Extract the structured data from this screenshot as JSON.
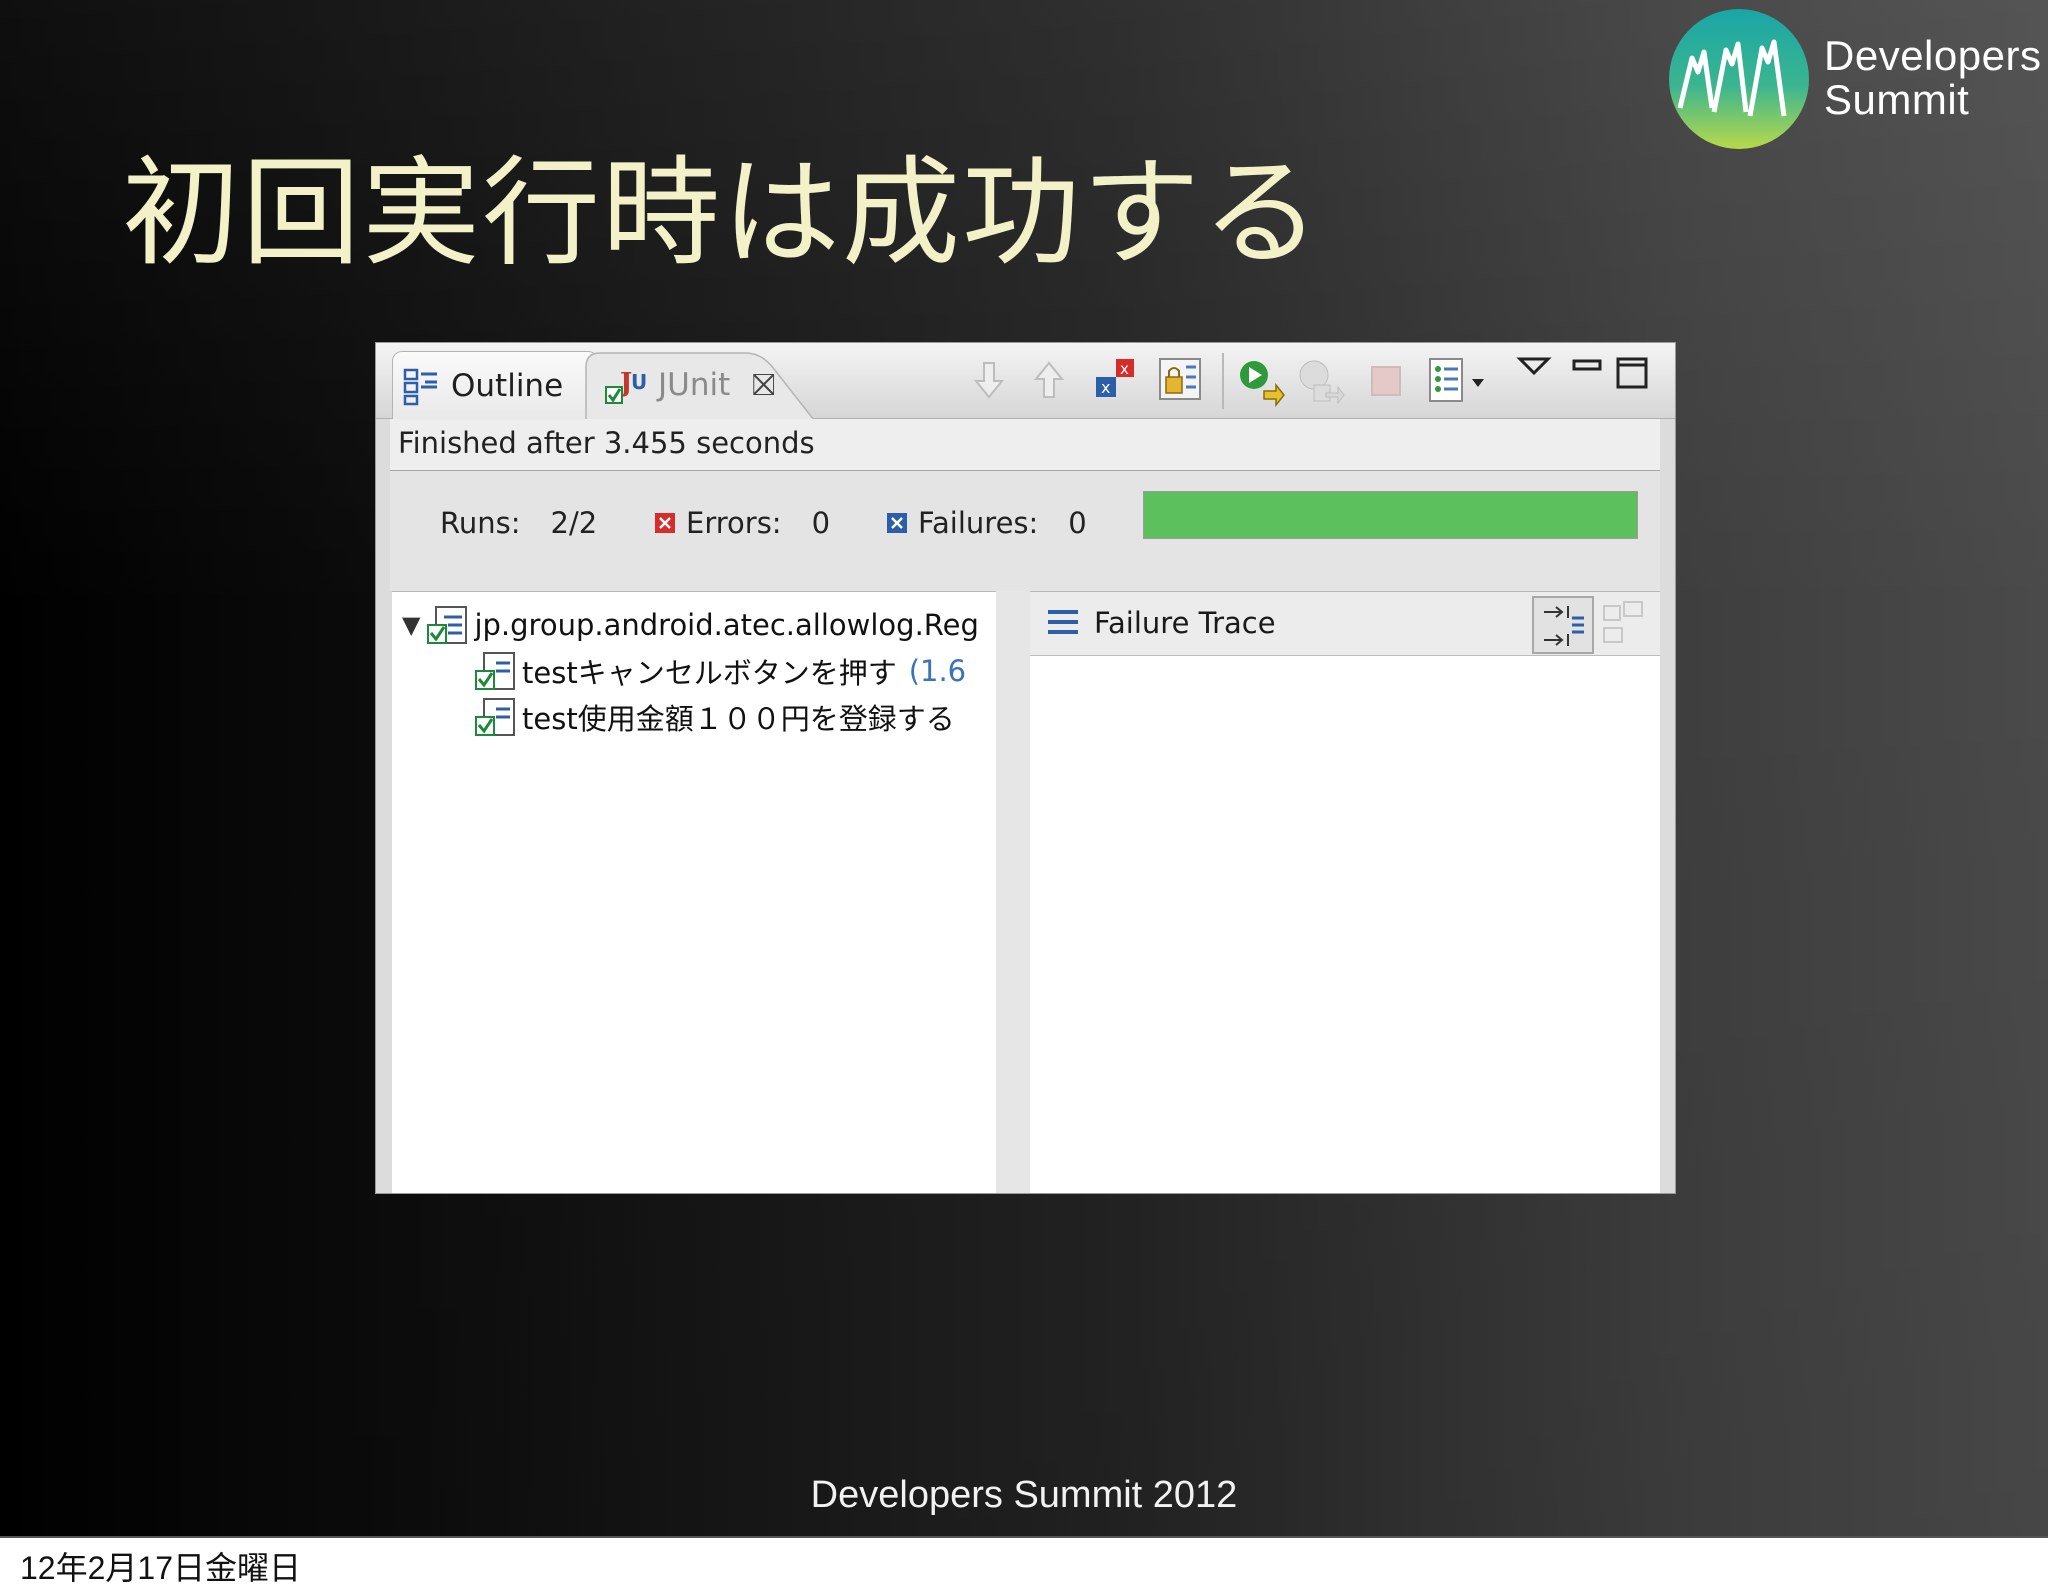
{
  "slide": {
    "title": "初回実行時は成功する",
    "footer": "Developers Summit 2012",
    "date_caption": "12年2月17日金曜日"
  },
  "logo": {
    "line1": "Developers",
    "line2": "Summit"
  },
  "eclipse_view": {
    "tabs": [
      {
        "label": "Outline",
        "icon": "outline-icon",
        "active": false
      },
      {
        "label": "JUnit",
        "icon": "junit-icon",
        "active": true,
        "close_glyph": "⛝"
      }
    ],
    "toolbar_icons": [
      "next-failure-icon",
      "previous-failure-icon",
      "show-failures-only-icon",
      "scroll-lock-icon",
      "rerun-test-icon",
      "rerun-failed-first-icon",
      "stop-icon",
      "test-run-history-icon",
      "view-menu-icon",
      "minimize-icon",
      "maximize-icon"
    ],
    "status": "Finished after 3.455 seconds",
    "counters": {
      "runs_label": "Runs:",
      "runs_value": "2/2",
      "errors_label": "Errors:",
      "errors_value": "0",
      "failures_label": "Failures:",
      "failures_value": "0"
    },
    "progress": {
      "fraction": 1.0,
      "color": "#5cc05c"
    },
    "tree": [
      {
        "label": "jp.group.android.atec.allowlog.Reg",
        "icon": "test-suite-icon",
        "expanded": true,
        "level": 0
      },
      {
        "label": "testキャンセルボタンを押す",
        "time": "(1.6",
        "icon": "test-pass-icon",
        "level": 1
      },
      {
        "label": "test使用金額１００円を登録する",
        "time": "",
        "icon": "test-pass-icon",
        "level": 1
      }
    ],
    "failure_trace": {
      "title": "Failure Trace",
      "icons": [
        "trace-list-icon",
        "filter-stack-icon",
        "compare-result-icon"
      ]
    }
  }
}
